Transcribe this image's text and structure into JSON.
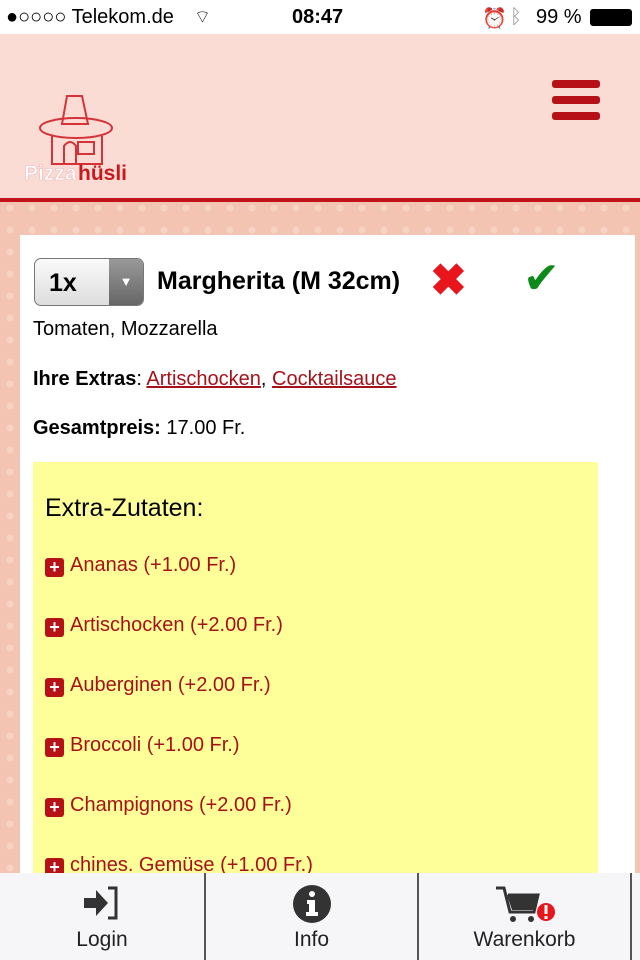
{
  "status_bar": {
    "carrier": "●○○○○ Telekom.de",
    "time": "08:47",
    "battery": "99 %"
  },
  "header": {
    "logo_text": "Pizzahüsli",
    "menu_icon": "hamburger-icon"
  },
  "colors": {
    "brand_red": "#b51116",
    "extras_bg": "#ffff99",
    "remove": "#e8161c",
    "confirm": "#0d8a1a"
  },
  "item": {
    "quantity": "1x",
    "name": "Margherita (M 32cm)",
    "ingredients": "Tomaten, Mozzarella",
    "extras_label": "Ihre Extras",
    "extras": [
      "Artischocken",
      "Cocktailsauce"
    ],
    "price_label": "Gesamtpreis:",
    "price": "17.00 Fr."
  },
  "extra_zutaten": {
    "title": "Extra-Zutaten:",
    "items": [
      "Ananas (+1.00 Fr.)",
      "Artischocken (+2.00 Fr.)",
      "Auberginen (+2.00 Fr.)",
      "Broccoli (+1.00 Fr.)",
      "Champignons (+2.00 Fr.)",
      "chines. Gemüse (+1.00 Fr.)"
    ]
  },
  "tabbar": [
    {
      "label": "Login",
      "icon": "login-icon"
    },
    {
      "label": "Info",
      "icon": "info-icon"
    },
    {
      "label": "Warenkorb",
      "icon": "cart-icon"
    }
  ]
}
